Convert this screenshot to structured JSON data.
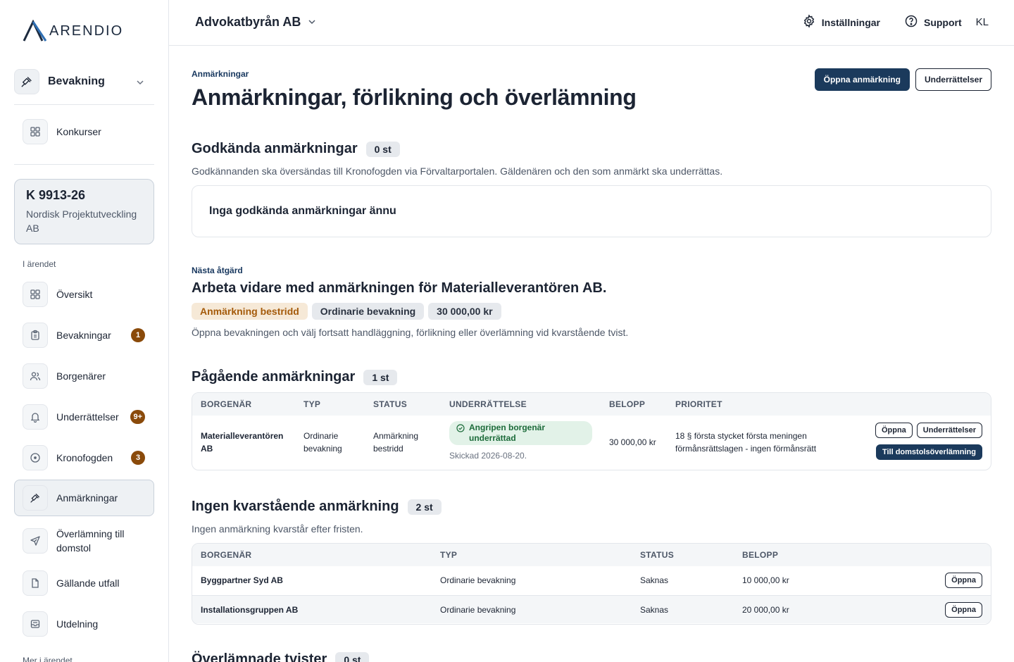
{
  "brand": {
    "logo_text": "ARENDIO"
  },
  "sidebar": {
    "module": "Bevakning",
    "top_items": [
      {
        "label": "Konkurser",
        "icon": "grid-icon"
      }
    ],
    "case": {
      "number": "K 9913-26",
      "name": "Nordisk Projektutveckling AB"
    },
    "section_label": "I ärendet",
    "items": [
      {
        "label": "Översikt",
        "icon": "grid-icon",
        "badge": ""
      },
      {
        "label": "Bevakningar",
        "icon": "clipboard-icon",
        "badge": "1"
      },
      {
        "label": "Borgenärer",
        "icon": "users-icon",
        "badge": ""
      },
      {
        "label": "Underrättelser",
        "icon": "bell-icon",
        "badge": "9+"
      },
      {
        "label": "Kronofogden",
        "icon": "circle-icon",
        "badge": "3"
      },
      {
        "label": "Anmärkningar",
        "icon": "gavel-icon",
        "badge": "",
        "active": true
      },
      {
        "label": "Överlämning till domstol",
        "icon": "send-icon",
        "badge": ""
      },
      {
        "label": "Gällande utfall",
        "icon": "document-icon",
        "badge": ""
      },
      {
        "label": "Utdelning",
        "icon": "inbox-icon",
        "badge": ""
      }
    ],
    "more_label": "Mer i ärendet"
  },
  "topbar": {
    "org": "Advokatbyrån AB",
    "settings": "Inställningar",
    "support": "Support",
    "user_initials": "KL"
  },
  "page": {
    "eyebrow": "Anmärkningar",
    "title": "Anmärkningar, förlikning och överlämning",
    "buttons": {
      "open": "Öppna anmärkning",
      "notices": "Underrättelser"
    }
  },
  "approved": {
    "title": "Godkända anmärkningar",
    "count": "0 st",
    "description": "Godkännanden ska översändas till Kronofogden via Förvaltarportalen. Gäldenären och den som anmärkt ska underrättas.",
    "empty": "Inga godkända anmärkningar ännu"
  },
  "next_action": {
    "eyebrow": "Nästa åtgärd",
    "title": "Arbeta vidare med anmärkningen för Materialleverantören AB.",
    "tags": [
      "Anmärkning bestridd",
      "Ordinarie bevakning",
      "30 000,00 kr"
    ],
    "description": "Öppna bevakningen och välj fortsatt handläggning, förlikning eller överlämning vid kvarstående tvist."
  },
  "ongoing": {
    "title": "Pågående anmärkningar",
    "count": "1 st",
    "headers": [
      "Borgenär",
      "Typ",
      "Status",
      "Underrättelse",
      "Belopp",
      "Prioritet"
    ],
    "row": {
      "creditor": "Materialleverantören AB",
      "type": "Ordinarie bevakning",
      "status": "Anmärkning bestridd",
      "notice_status": "Angripen borgenär underrättad",
      "notice_sent": "Skickad 2026-08-20.",
      "amount": "30 000,00 kr",
      "priority": "18 § första stycket första meningen förmånsrättslagen - ingen förmånsrätt",
      "actions": {
        "open": "Öppna",
        "notices": "Underrättelser",
        "court": "Till domstolsöverlämning"
      }
    }
  },
  "no_remaining": {
    "title": "Ingen kvarstående anmärkning",
    "count": "2 st",
    "description": "Ingen anmärkning kvarstår efter fristen.",
    "headers": [
      "Borgenär",
      "Typ",
      "Status",
      "Belopp"
    ],
    "rows": [
      {
        "creditor": "Byggpartner Syd AB",
        "type": "Ordinarie bevakning",
        "status": "Saknas",
        "amount": "10 000,00 kr",
        "action": "Öppna"
      },
      {
        "creditor": "Installationsgruppen AB",
        "type": "Ordinarie bevakning",
        "status": "Saknas",
        "amount": "20 000,00 kr",
        "action": "Öppna"
      }
    ]
  },
  "handed_over": {
    "title": "Överlämnade tvister",
    "count": "0 st"
  }
}
